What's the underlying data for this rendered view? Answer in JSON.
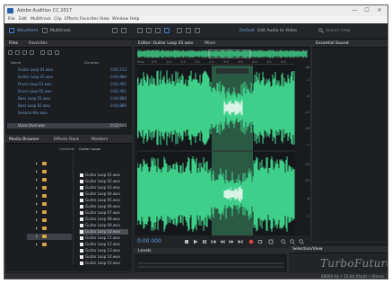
{
  "window": {
    "title": "Adobe Audition CC 2017",
    "controls": [
      "—",
      "☐",
      "✕"
    ]
  },
  "menus": [
    "File",
    "Edit",
    "Multitrack",
    "Clip",
    "Effects",
    "Favorites",
    "View",
    "Window",
    "Help"
  ],
  "toolbar": {
    "waveform_label": "Waveform",
    "multitrack_label": "Multitrack",
    "workspace_label": "Default",
    "workspace_menu": "Edit Audio to Video",
    "search_placeholder": "Search Help"
  },
  "files_panel": {
    "tab": "Files",
    "tab2": "Favorites",
    "col_name": "Name",
    "col_dur": "Duration",
    "items": [
      {
        "name": "Guitar Loop 01.wav",
        "dur": "0:05.213"
      },
      {
        "name": "Guitar Loop 02.wav",
        "dur": "0:04.880"
      },
      {
        "name": "Drum Loop 01.wav",
        "dur": "0:02.401"
      },
      {
        "name": "Drum Loop 02.wav",
        "dur": "0:02.401"
      },
      {
        "name": "Bass Loop 01.wav",
        "dur": "0:04.880"
      },
      {
        "name": "Bass Loop 02.wav",
        "dur": "0:04.880"
      },
      {
        "name": "Session Mix.wav",
        "dur": ""
      },
      {
        "name": "Voice Over.wav",
        "dur": "0:12.600"
      }
    ]
  },
  "media_panel": {
    "tab": "Media Browser",
    "tab2": "Effects Rack",
    "tab3": "Markers",
    "contents_label": "Contents",
    "path_label": "Guitar Loops",
    "list_items": [
      "Guitar Loop 01.wav",
      "Guitar Loop 02.wav",
      "Guitar Loop 03.wav",
      "Guitar Loop 04.wav",
      "Guitar Loop 05.wav",
      "Guitar Loop 06.wav",
      "Guitar Loop 07.wav",
      "Guitar Loop 08.wav",
      "Guitar Loop 09.wav",
      "Guitar Loop 10.wav",
      "Guitar Loop 11.wav",
      "Guitar Loop 12.wav",
      "Guitar Loop 13.wav",
      "Guitar Loop 14.wav",
      "Guitar Loop 15.wav"
    ],
    "selected_index": 9
  },
  "editor": {
    "tab": "Editor: Guitar Loop 01.wav",
    "tab2": "Mixer",
    "ruler": [
      "hms",
      "0.5",
      "1.0",
      "1.5",
      "2.0",
      "2.5",
      "3.0",
      "3.5",
      "4.0",
      "4.5",
      "5.0"
    ],
    "db_scale": [
      "dB",
      "-3",
      "-6",
      "-12",
      "-18",
      "-∞",
      "-18",
      "-12",
      "-6",
      "-3"
    ],
    "time_display": "0:00.000",
    "waveform_color": "#3ed08a",
    "selection_color": "#2b5a44"
  },
  "properties_panel": {
    "tab": "Essential Sound"
  },
  "levels_panel": {
    "tab": "Levels"
  },
  "selection_panel": {
    "tab": "Selection/View"
  },
  "status": {
    "text": "48000 Hz • 32-bit (float) • Stereo"
  },
  "watermark": "TurboFuture",
  "colors": {
    "accent": "#3ed08a",
    "folder": "#d7a84b",
    "link": "#6f9dcf"
  }
}
